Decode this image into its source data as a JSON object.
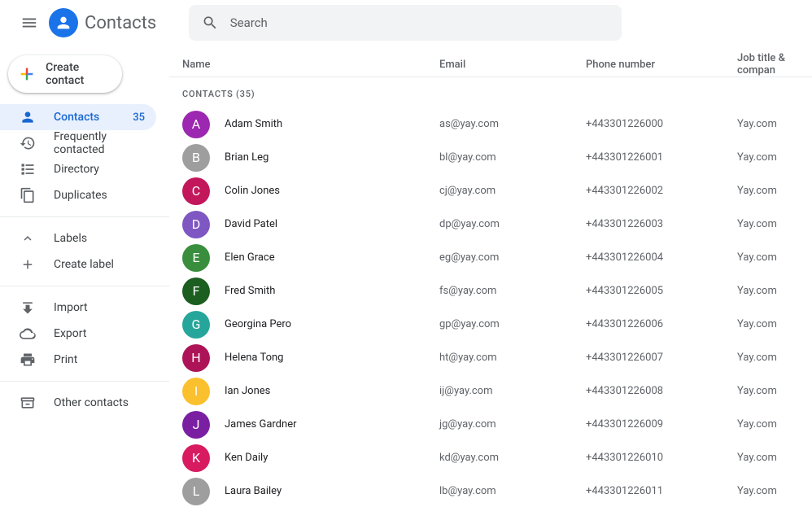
{
  "header": {
    "app_name": "Contacts",
    "search_placeholder": "Search"
  },
  "sidebar": {
    "create_label": "Create contact",
    "items": [
      {
        "label": "Contacts",
        "count": "35"
      },
      {
        "label": "Frequently contacted"
      },
      {
        "label": "Directory"
      },
      {
        "label": "Duplicates"
      }
    ],
    "section_labels": "Labels",
    "create_label_item": "Create label",
    "items2": [
      {
        "label": "Import"
      },
      {
        "label": "Export"
      },
      {
        "label": "Print"
      }
    ],
    "other": "Other contacts"
  },
  "table": {
    "headers": {
      "name": "Name",
      "email": "Email",
      "phone": "Phone number",
      "job": "Job title & compan"
    },
    "section_label": "CONTACTS (35)",
    "rows": [
      {
        "initial": "A",
        "color": "#9c27b0",
        "name": "Adam Smith",
        "email": "as@yay.com",
        "phone": "+443301226000",
        "job": "Yay.com"
      },
      {
        "initial": "B",
        "color": "#9e9e9e",
        "name": "Brian Leg",
        "email": "bl@yay.com",
        "phone": "+443301226001",
        "job": "Yay.com"
      },
      {
        "initial": "C",
        "color": "#c2185b",
        "name": "Colin Jones",
        "email": "cj@yay.com",
        "phone": "+443301226002",
        "job": "Yay.com"
      },
      {
        "initial": "D",
        "color": "#7e57c2",
        "name": "David Patel",
        "email": "dp@yay.com",
        "phone": "+443301226003",
        "job": "Yay.com"
      },
      {
        "initial": "E",
        "color": "#388e3c",
        "name": "Elen Grace",
        "email": "eg@yay.com",
        "phone": "+443301226004",
        "job": "Yay.com"
      },
      {
        "initial": "F",
        "color": "#1b5e20",
        "name": "Fred Smith",
        "email": "fs@yay.com",
        "phone": "+443301226005",
        "job": "Yay.com"
      },
      {
        "initial": "G",
        "color": "#26a69a",
        "name": "Georgina Pero",
        "email": "gp@yay.com",
        "phone": "+443301226006",
        "job": "Yay.com"
      },
      {
        "initial": "H",
        "color": "#ad1457",
        "name": "Helena Tong",
        "email": "ht@yay.com",
        "phone": "+443301226007",
        "job": "Yay.com"
      },
      {
        "initial": "I",
        "color": "#fbc02d",
        "name": "Ian Jones",
        "email": "ij@yay.com",
        "phone": "+443301226008",
        "job": "Yay.com"
      },
      {
        "initial": "J",
        "color": "#7b1fa2",
        "name": "James Gardner",
        "email": "jg@yay.com",
        "phone": "+443301226009",
        "job": "Yay.com"
      },
      {
        "initial": "K",
        "color": "#d81b60",
        "name": "Ken Daily",
        "email": "kd@yay.com",
        "phone": "+443301226010",
        "job": "Yay.com"
      },
      {
        "initial": "L",
        "color": "#9e9e9e",
        "name": "Laura Bailey",
        "email": "lb@yay.com",
        "phone": "+443301226011",
        "job": "Yay.com"
      }
    ]
  }
}
